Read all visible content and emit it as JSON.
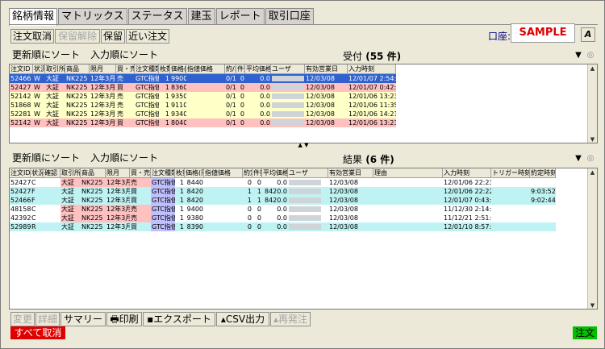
{
  "tabs": [
    "銘柄情報",
    "マトリックス",
    "ステータス",
    "建玉",
    "レポート",
    "取引口座"
  ],
  "toolbar": {
    "cancel_order": "注文取消",
    "release_hold": "保留解除",
    "hold": "保留",
    "near_order": "近い注文"
  },
  "account": {
    "label": "口座:",
    "value": "SAMPLE",
    "font_button": "A"
  },
  "sort": {
    "by_update": "更新順にソート",
    "by_entry": "入力順にソート"
  },
  "received": {
    "title": "受付",
    "count": "(55 件)",
    "columns": [
      "注文ID",
      "状況",
      "取引所",
      "商品",
      "限月",
      "買・売",
      "注文種類",
      "枚数",
      "価格(円)",
      "指値価格",
      "約/未",
      "件数",
      "平均価格",
      "ユーザ",
      "有効営業日",
      "入力時刻"
    ],
    "rows": [
      [
        "52466",
        "W",
        "大証",
        "NK225",
        "12年3月",
        "売",
        "GTC指値",
        "1",
        "9900",
        "",
        "0/1",
        "0",
        "0.0",
        "",
        "12/03/08",
        "12/01/07 2:54:12"
      ],
      [
        "52427",
        "W",
        "大証",
        "NK225",
        "12年3月",
        "買",
        "GTC指値",
        "1",
        "8360",
        "",
        "0/1",
        "0",
        "0.0",
        "",
        "12/03/08",
        "12/01/07 0:42:3"
      ],
      [
        "52142",
        "W",
        "大証",
        "NK225",
        "12年3月",
        "売",
        "GTC指値",
        "1",
        "9350",
        "",
        "0/1",
        "0",
        "0.0",
        "",
        "12/03/08",
        "12/01/06 13:23"
      ],
      [
        "51868",
        "W",
        "大証",
        "NK225",
        "12年3月",
        "売",
        "GTC指値",
        "1",
        "9110",
        "",
        "0/1",
        "0",
        "0.0",
        "",
        "12/03/08",
        "12/01/06 11:35"
      ],
      [
        "52281",
        "W",
        "大証",
        "NK225",
        "12年3月",
        "売",
        "GTC指値",
        "1",
        "9340",
        "",
        "0/1",
        "0",
        "0.0",
        "",
        "12/03/08",
        "12/01/06 14:21"
      ],
      [
        "52142",
        "W",
        "大証",
        "NK225",
        "12年3月",
        "買",
        "GTC指値",
        "1",
        "8040",
        "",
        "0/1",
        "0",
        "0.0",
        "",
        "12/03/08",
        "12/01/06 13:23"
      ]
    ]
  },
  "results": {
    "title": "結果",
    "count": "(6 件)",
    "columns": [
      "注文ID",
      "状況",
      "確認",
      "取引所",
      "商品",
      "限月",
      "買・売",
      "注文種類",
      "枚数",
      "価格(円)",
      "指値価格",
      "約定",
      "件数",
      "平均価格",
      "ユーザ",
      "有効営業日",
      "理由",
      "入力時刻",
      "トリガー時刻",
      "約定時刻"
    ],
    "rows": [
      [
        "52427",
        "C",
        "",
        "大証",
        "NK225",
        "12年3月",
        "売",
        "GTC指値",
        "1",
        "8440",
        "",
        "0",
        "0",
        "0.0",
        "",
        "12/03/08",
        "",
        "12/01/06 22:23",
        "",
        ""
      ],
      [
        "52427",
        "F",
        "",
        "大証",
        "NK225",
        "12年3月",
        "買",
        "GTC指値",
        "1",
        "8420",
        "",
        "1",
        "1",
        "8420.0",
        "",
        "12/03/08",
        "",
        "12/01/06 22:22",
        "",
        "9:03:52"
      ],
      [
        "52466",
        "F",
        "",
        "大証",
        "NK225",
        "12年3月",
        "買",
        "GTC指値",
        "1",
        "8420",
        "",
        "1",
        "1",
        "8420.0",
        "",
        "12/03/08",
        "",
        "12/01/07 0:43:5",
        "",
        "9:02:44"
      ],
      [
        "48158",
        "C",
        "",
        "大証",
        "NK225",
        "12年3月",
        "売",
        "GTC指値",
        "1",
        "9400",
        "",
        "0",
        "0",
        "0.0",
        "",
        "12/03/08",
        "",
        "11/12/30 2:14:4",
        "",
        ""
      ],
      [
        "42392",
        "C",
        "",
        "大証",
        "NK225",
        "12年3月",
        "売",
        "GTC指値",
        "1",
        "9380",
        "",
        "0",
        "0",
        "0.0",
        "",
        "12/03/08",
        "",
        "11/12/21 2:51:2",
        "",
        ""
      ],
      [
        "52989",
        "R",
        "",
        "大証",
        "NK225",
        "12年3月",
        "買",
        "GTC指値",
        "1",
        "8390",
        "",
        "0",
        "0",
        "0.0",
        "",
        "12/03/08",
        "",
        "12/01/10 8:57:0",
        "",
        ""
      ]
    ]
  },
  "bottom": {
    "change": "変更",
    "detail": "詳細",
    "summary": "サマリー",
    "print": "印刷",
    "export": "エクスポート",
    "csv": "CSV出力",
    "reorder": "再発注",
    "cancel_all": "すべて取消",
    "order": "注文"
  },
  "icons": {
    "filter": "funnel-icon",
    "settings": "settings-icon",
    "printer": "printer-icon",
    "save": "floppy-icon"
  },
  "colors": {
    "sell_row": "#ffffc8",
    "buy_row": "#ffc0c0",
    "selected_row": "#2f62d0",
    "filled_row": "#bff2f2",
    "type_cell": "#c0c0ff",
    "cancel_all_bg": "#e00000",
    "order_bg": "#00c000",
    "account_text": "#e00000"
  }
}
